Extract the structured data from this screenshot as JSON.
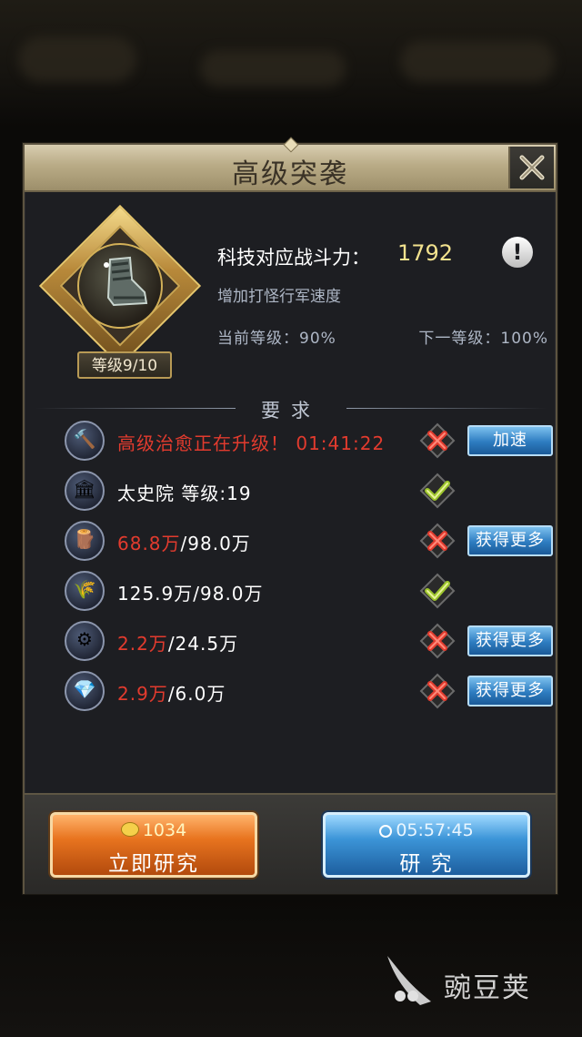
{
  "dialog": {
    "title": "高级突袭",
    "level_badge": "等级9/10",
    "power_label": "科技对应战斗力：",
    "power_value": "1792",
    "description": "增加打怪行军速度",
    "current_level": "当前等级：90%",
    "next_level": "下一等级：100%",
    "requirements_heading": "要求"
  },
  "requirements": [
    {
      "icon": "hammer-scroll-icon",
      "part1": "高级治愈正在升级！ 01:41:22",
      "part2": "",
      "met": false,
      "button": "加速"
    },
    {
      "icon": "building-icon",
      "part1": "",
      "part2": "太史院 等级:19",
      "met": true,
      "button": ""
    },
    {
      "icon": "wood-icon",
      "part1": "68.8万",
      "part2": "/98.0万",
      "met": false,
      "button": "获得更多"
    },
    {
      "icon": "wheat-icon",
      "part1": "",
      "part2": "125.9万/98.0万",
      "met": true,
      "button": ""
    },
    {
      "icon": "iron-icon",
      "part1": "2.2万",
      "part2": "/24.5万",
      "met": false,
      "button": "获得更多"
    },
    {
      "icon": "crystal-icon",
      "part1": "2.9万",
      "part2": "/6.0万",
      "met": false,
      "button": "获得更多"
    }
  ],
  "footer": {
    "instant_cost": "1034",
    "instant_label": "立即研究",
    "research_time": "05:57:45",
    "research_label": "研 究"
  },
  "watermark": "豌豆荚",
  "colors": {
    "accent_red": "#e23b2e",
    "power_gold": "#f2e28e",
    "button_blue": "#2d7cc0",
    "button_orange": "#e8741f"
  }
}
